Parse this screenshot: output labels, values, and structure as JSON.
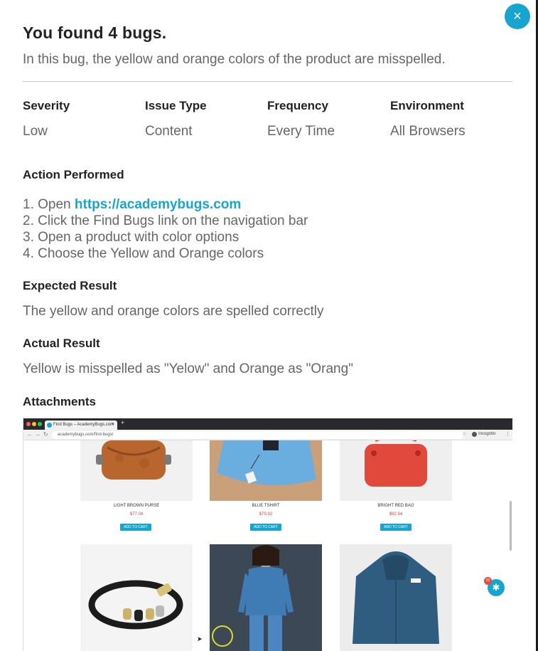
{
  "modal": {
    "title": "You found 4 bugs.",
    "subtitle": "In this bug, the yellow and orange colors of the product are misspelled.",
    "close_icon": "×"
  },
  "meta": [
    {
      "label": "Severity",
      "value": "Low"
    },
    {
      "label": "Issue Type",
      "value": "Content"
    },
    {
      "label": "Frequency",
      "value": "Every Time"
    },
    {
      "label": "Environment",
      "value": "All Browsers"
    }
  ],
  "action": {
    "label": "Action Performed",
    "steps": [
      {
        "num": "1.",
        "prefix": "Open ",
        "link": "https://academybugs.com"
      },
      {
        "num": "2.",
        "text": "Click the Find Bugs link on the navigation bar"
      },
      {
        "num": "3.",
        "text": "Open a product with color options"
      },
      {
        "num": "4.",
        "text": "Choose the Yellow and Orange colors"
      }
    ]
  },
  "expected": {
    "label": "Expected Result",
    "text": "The yellow and orange colors are spelled correctly"
  },
  "actual": {
    "label": "Actual Result",
    "text": "Yellow is misspelled as \"Yelow\" and Orange as \"Orang\""
  },
  "attachments": {
    "label": "Attachments",
    "browser": {
      "tab_title": "Find Bugs – AcademyBugs.com",
      "url": "academybugs.com/find-bugs/",
      "incognito": "Incognito",
      "tab_close": "×",
      "tab_plus": "+"
    },
    "products": [
      {
        "name": "LIGHT BROWN PURSE",
        "price": "$77.04",
        "button": "ADD TO CART"
      },
      {
        "name": "BLUE TSHIRT",
        "price": "$79.92",
        "button": "ADD TO CART"
      },
      {
        "name": "BRIGHT RED BAG",
        "price": "$92.94",
        "button": "ADD TO CART"
      }
    ],
    "bug_badge": "25",
    "colors": {
      "accent": "#17a5cf",
      "price": "#e03c3c"
    }
  }
}
